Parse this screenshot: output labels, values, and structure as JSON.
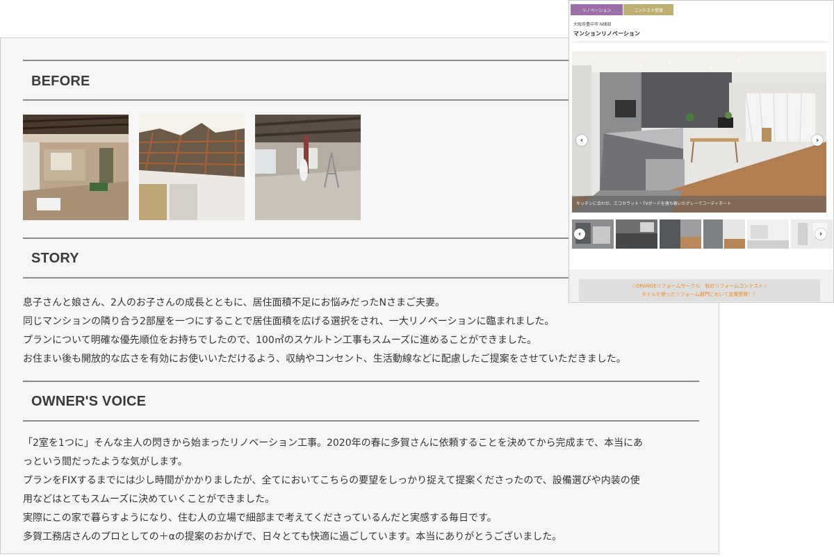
{
  "before": {
    "heading": "BEFORE"
  },
  "story": {
    "heading": "STORY",
    "lines": [
      "息子さんと娘さん、2人のお子さんの成長とともに、居住面積不足にお悩みだったNさまご夫妻。",
      "同じマンションの隣り合う2部屋を一つにすることで居住面積を広げる選択をされ、一大リノベーションに臨まれました。",
      "プランについて明確な優先順位をお持ちでしたので、100㎡のスケルトン工事もスムーズに進めることができました。",
      "お住まい後も開放的な広さを有効にお使いいただけるよう、収納やコンセント、生活動線などに配慮したご提案をさせていただきました。"
    ]
  },
  "voice": {
    "heading": "OWNER'S VOICE",
    "lines": [
      "「2室を1つに」そんな主人の閃きから始まったリノベーション工事。2020年の春に多賀さんに依頼することを決めてから完成まで、本当にあ",
      "っという間だったような気がします。",
      "プランをFIXするまでには少し時間がかかりましたが、全てにおいてこちらの要望をしっかり捉えて提案くださったので、設備選びや内装の使",
      "用などはとてもスムーズに決めていくことができました。",
      "実際にこの家で暮らすようになり、住む人の立場で細部まで考えてくださっているんだと実感する毎日です。",
      "多賀工務店さんのプロとしての＋αの提案のおかげで、日々とても快適に過ごしています。本当にありがとうございました。"
    ]
  },
  "card": {
    "tag_renovation": "リノベーション",
    "tag_contest": "コンテスト受賞",
    "tag_renovation_color": "#9c6fa8",
    "tag_contest_color": "#bfae72",
    "location": "大阪府豊中市 N様邸",
    "title": "マンションリノベーション",
    "caption": "キッチンに合わせ、エコカラット・TVボードを落ち着いたグレーでコーディネート",
    "prev_icon": "chevron-left-icon",
    "next_icon": "chevron-right-icon",
    "prev_glyph": "‹",
    "next_glyph": "›",
    "award_line1": "☆ORANGEリフォームサークル　秋のリフォームコンテスト☆",
    "award_line2": "タイルを使ったリフォーム部門において金賞受賞！！",
    "award_color": "#f28b1c"
  }
}
